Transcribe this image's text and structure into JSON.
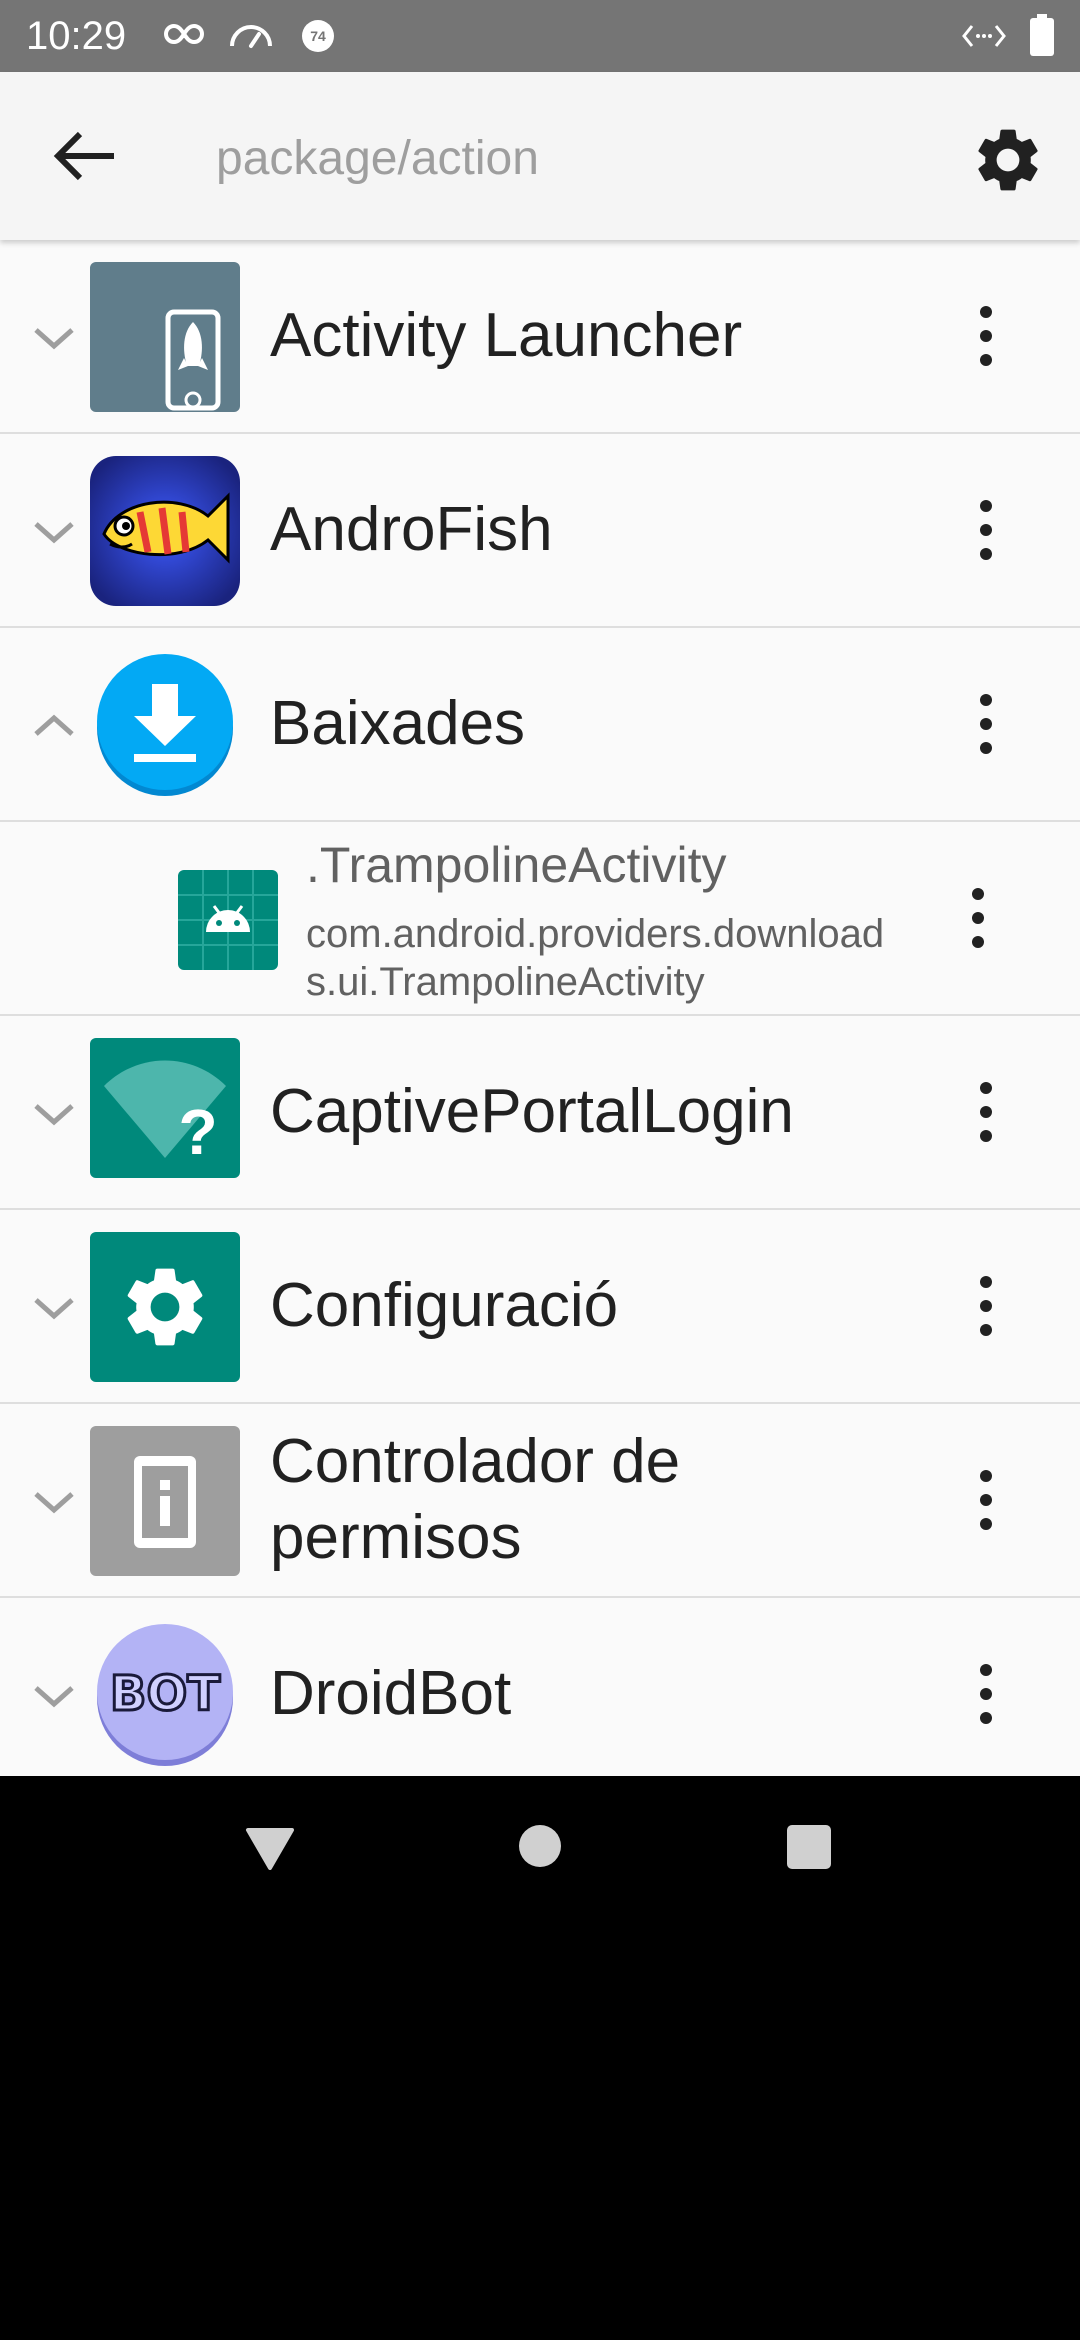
{
  "status_bar": {
    "time": "10:29",
    "left_icons": [
      "infinity-icon",
      "speedometer-icon",
      "badge-74-icon"
    ],
    "badge_text": "74",
    "right_icons": [
      "code-brackets-icon",
      "battery-icon"
    ]
  },
  "app_bar": {
    "back_icon": "arrow-back-icon",
    "search_placeholder": "package/action",
    "search_value": "",
    "settings_icon": "gear-icon"
  },
  "list": {
    "items": [
      {
        "label": "Activity Launcher",
        "expanded": false,
        "icon": "activity-launcher-icon"
      },
      {
        "label": "AndroFish",
        "expanded": false,
        "icon": "androfish-icon"
      },
      {
        "label": "Baixades",
        "expanded": true,
        "icon": "downloads-icon",
        "children": [
          {
            "title": ".TrampolineActivity",
            "subtitle": "com.android.providers.downloads.ui.TrampolineActivity",
            "icon": "android-default-icon"
          }
        ]
      },
      {
        "label": "CaptivePortalLogin",
        "expanded": false,
        "icon": "wifi-question-icon"
      },
      {
        "label": "Configuració",
        "expanded": false,
        "icon": "settings-app-icon"
      },
      {
        "label": "Controlador de permisos",
        "expanded": false,
        "icon": "permission-controller-icon"
      },
      {
        "label": "DroidBot",
        "expanded": false,
        "icon": "droidbot-icon",
        "icon_text": "BOT"
      }
    ]
  },
  "nav_bar": {
    "buttons": [
      "back-triangle-icon",
      "home-circle-icon",
      "recents-square-icon"
    ]
  },
  "colors": {
    "status_bar": "#757575",
    "app_bar": "#f5f5f5",
    "list_background": "#fafafa",
    "divider": "#dedede",
    "teal_icon": "#00897b",
    "downloads_blue": "#03a9f4"
  }
}
